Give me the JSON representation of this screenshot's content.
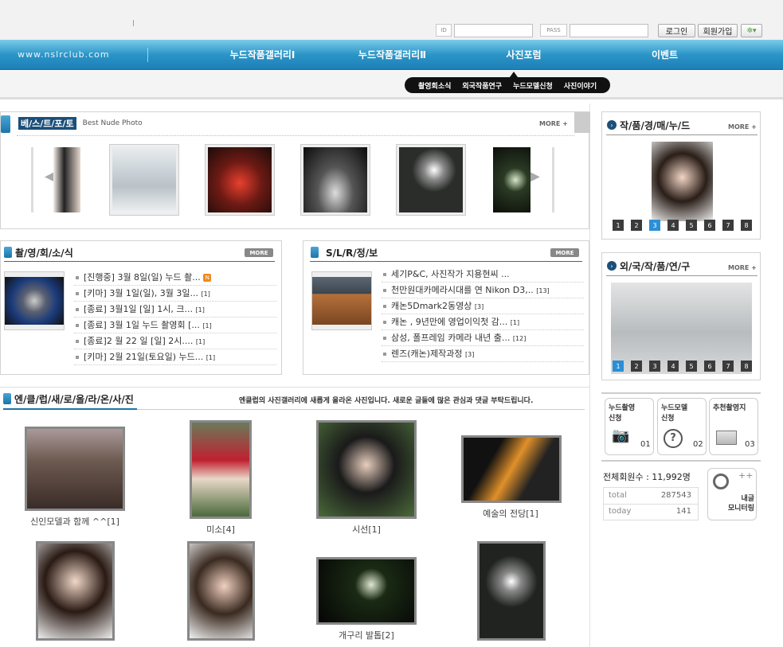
{
  "top": {
    "id_label": "ID",
    "pass_label": "PASS",
    "login": "로그인",
    "join": "회원가입"
  },
  "nav": {
    "site": "www.nslrclub.com",
    "items": [
      "누드작품갤러리Ⅰ",
      "누드작품갤러리Ⅱ",
      "사진포럼",
      "이벤트"
    ]
  },
  "subnav": [
    "촬영회소식",
    "외국작품연구",
    "누드모델신청",
    "사진이야기"
  ],
  "best": {
    "title": "베/스/트/포/토",
    "subtitle": "Best Nude Photo",
    "more": "MORE +"
  },
  "shoot": {
    "title": "촬/영/회/소/식",
    "more": "MORE",
    "items": [
      {
        "text": "[진행중] 3월 8일(일) 누드 촬...",
        "count": "",
        "new": "N"
      },
      {
        "text": "[키마] 3월 1일(일), 3월 3일...",
        "count": "[1]",
        "new": ""
      },
      {
        "text": "[종료] 3월1일 [일] 1시, 크...",
        "count": "[1]",
        "new": ""
      },
      {
        "text": "[종료] 3월 1일 누드 촬영회 [...",
        "count": "[1]",
        "new": ""
      },
      {
        "text": "[종료]2 월 22 일 [일] 2시....",
        "count": "[1]",
        "new": ""
      },
      {
        "text": "[키마] 2월 21일(토요일) 누드...",
        "count": "[1]",
        "new": ""
      }
    ]
  },
  "slr": {
    "title": "S/L/R/정/보",
    "more": "MORE",
    "items": [
      {
        "text": "세기P&C, 사진작가 지용현씨 ...",
        "count": ""
      },
      {
        "text": "천만원대카메라시대를 연 Nikon D3,..",
        "count": "[13]"
      },
      {
        "text": "캐논5Dmark2동영상",
        "count": "[3]"
      },
      {
        "text": "캐논 , 9년만에 영업이익첫 감...",
        "count": "[1]"
      },
      {
        "text": "삼성, 폴프레임 카메라 내년 출...",
        "count": "[12]"
      },
      {
        "text": "렌즈(캐논)제작과정",
        "count": "[3]"
      }
    ]
  },
  "auction": {
    "title": "작/품/경/매/누/드",
    "more": "MORE +",
    "pages": [
      "1",
      "2",
      "3",
      "4",
      "5",
      "6",
      "7",
      "8"
    ],
    "active": 2
  },
  "foreign": {
    "title": "외/국/작/품/연/구",
    "more": "MORE +",
    "pages": [
      "1",
      "2",
      "3",
      "4",
      "5",
      "6",
      "7",
      "8"
    ],
    "active": 0
  },
  "newgal": {
    "title": "엔/클/럽/새/로/올/라/온/사/진",
    "desc": "엔클럽의 사진갤러리에 새롭게 올라온 사진입니다. 새로운 글들에 많은 관심과 댓글 부탁드립니다.",
    "captions": [
      "신인모델과 함께 ^^[1]",
      "미소[4]",
      "시선[1]",
      "예술의 전당[1]",
      "개구리 발톱[2]"
    ]
  },
  "quick": [
    {
      "label1": "누드촬영",
      "label2": "신청",
      "num": "01"
    },
    {
      "label1": "누드모델",
      "label2": "신청",
      "num": "02"
    },
    {
      "label1": "추천촬영지",
      "label2": "",
      "num": "03"
    }
  ],
  "stats": {
    "members": "전체회원수 : 11,992명",
    "total_label": "total",
    "total": "287543",
    "today_label": "today",
    "today": "141",
    "monitor1": "내글",
    "monitor2": "모니터링"
  },
  "colors": {
    "nav": "#2c95c7",
    "accent": "#2b8fd6",
    "pill": "#111111"
  }
}
